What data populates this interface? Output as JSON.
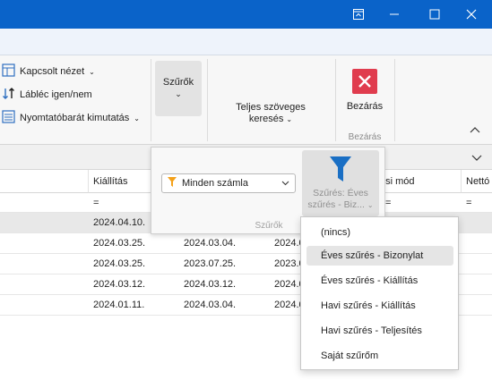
{
  "colors": {
    "titlebar": "#0a63c9",
    "close_red": "#e03c4e",
    "filter_funnel": "#1a6fc4",
    "filter_orange": "#f4a11a"
  },
  "ribbon": {
    "items": [
      {
        "label": "Kapcsolt nézet",
        "icon": "linked-view-icon"
      },
      {
        "label": "Lábléc igen/nem",
        "icon": "sort-arrows-icon"
      },
      {
        "label": "Nyomtatóbarát kimutatás",
        "icon": "list-report-icon"
      }
    ],
    "filters_button": "Szűrők",
    "fulltext_line1": "Teljes szöveges",
    "fulltext_line2": "keresés",
    "close_label": "Bezárás",
    "close_group": "Bezárás"
  },
  "filter_panel": {
    "select_value": "Minden számla",
    "button_line1": "Szűrés: Éves",
    "button_line2": "szűrés - Biz...",
    "group_label": "Szűrők"
  },
  "grid": {
    "headers": [
      "Kiállítás",
      "ési mód",
      "Nettó"
    ],
    "filter_symbol": "=",
    "rows": [
      {
        "a": "2024.04.10.",
        "b": "",
        "c": ""
      },
      {
        "a": "2024.03.25.",
        "b": "2024.03.04.",
        "c": "2024.0"
      },
      {
        "a": "2024.03.25.",
        "b": "2023.07.25.",
        "c": "2023.0"
      },
      {
        "a": "2024.03.12.",
        "b": "2024.03.12.",
        "c": "2024.0"
      },
      {
        "a": "2024.01.11.",
        "b": "2024.03.04.",
        "c": "2024.0"
      }
    ]
  },
  "dropdown": {
    "items": [
      "(nincs)",
      "Éves szűrés - Bizonylat",
      "Éves szűrés - Kiállítás",
      "Havi szűrés - Kiállítás",
      "Havi szűrés - Teljesítés",
      "Saját szűrőm"
    ],
    "selected_index": 1
  }
}
